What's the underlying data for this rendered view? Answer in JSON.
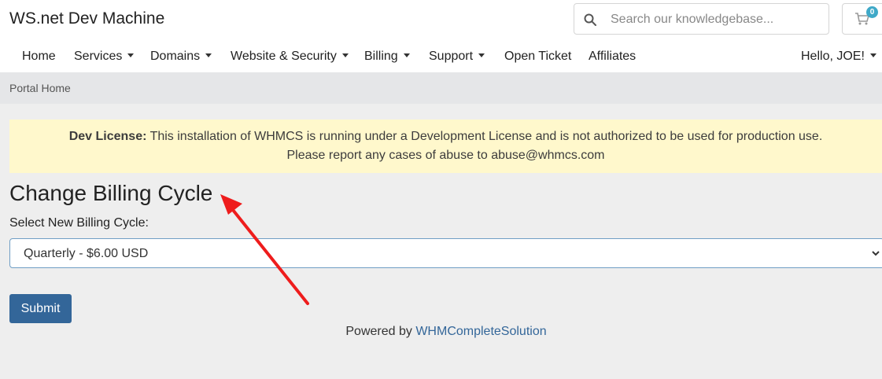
{
  "header": {
    "brand": "WS.net Dev Machine",
    "search_placeholder": "Search our knowledgebase...",
    "cart_count": "0"
  },
  "nav": {
    "items": [
      {
        "label": "Home",
        "dropdown": false
      },
      {
        "label": "Services",
        "dropdown": true
      },
      {
        "label": "Domains",
        "dropdown": true
      },
      {
        "label": "Website & Security",
        "dropdown": true
      },
      {
        "label": "Billing",
        "dropdown": true
      },
      {
        "label": "Support",
        "dropdown": true
      },
      {
        "label": "Open Ticket",
        "dropdown": false
      },
      {
        "label": "Affiliates",
        "dropdown": false
      }
    ],
    "account": "Hello, JOE!"
  },
  "breadcrumb": "Portal Home",
  "alert": {
    "strong": "Dev License:",
    "line1": "This installation of WHMCS is running under a Development License and is not authorized to be used for production use.",
    "line2": "Please report any cases of abuse to abuse@whmcs.com"
  },
  "main": {
    "title": "Change Billing Cycle",
    "select_label": "Select New Billing Cycle:",
    "selected_option": "Quarterly - $6.00 USD",
    "submit_label": "Submit"
  },
  "footer": {
    "prefix": "Powered by",
    "link": "WHMCompleteSolution"
  },
  "colors": {
    "primary": "#336699",
    "alert_bg": "#fff8cc",
    "annotation_arrow": "#ee1c1c"
  }
}
